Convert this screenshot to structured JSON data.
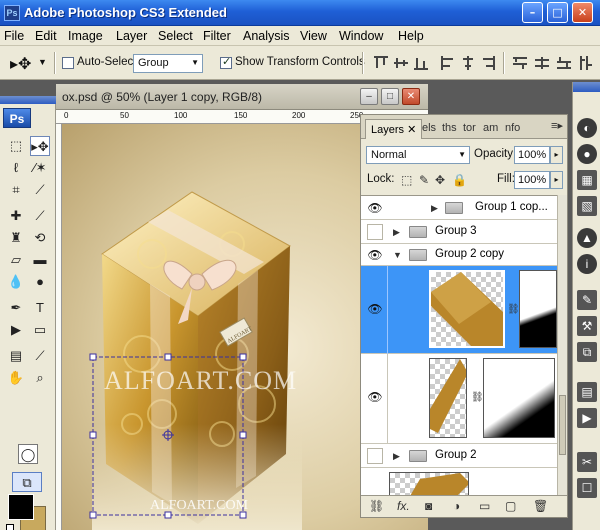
{
  "app": {
    "title": "Adobe Photoshop CS3 Extended",
    "logo_text": "Ps",
    "accent_color": "#1f5fd6"
  },
  "window_controls": {
    "minimize": "–",
    "maximize": "□",
    "close": "✕"
  },
  "menu": [
    "File",
    "Edit",
    "Image",
    "Layer",
    "Select",
    "Filter",
    "Analysis",
    "View",
    "Window",
    "Help"
  ],
  "options_bar": {
    "auto_select_label": "Auto-Select:",
    "auto_select_checked": false,
    "auto_select_value": "Group",
    "show_transform_label": "Show Transform Controls",
    "show_transform_checked": true
  },
  "document": {
    "title": "ox.psd @ 50% (Layer 1 copy, RGB/8)",
    "ruler_ticks": [
      "0",
      "50",
      "100",
      "150",
      "200",
      "250"
    ],
    "watermarks": [
      "ALFOART.COM",
      "ALFOART.COM"
    ],
    "tag_text": "ALFOART"
  },
  "layers_panel": {
    "tabs": [
      "Layers",
      "els",
      "ths",
      "tor",
      "am",
      "nfo"
    ],
    "blend_mode": "Normal",
    "opacity_label": "Opacity:",
    "opacity": "100%",
    "lock_label": "Lock:",
    "fill_label": "Fill:",
    "fill": "100%",
    "layers": [
      {
        "name": "Group 1 cop...",
        "visible": true
      },
      {
        "name": "Group 3",
        "visible": false
      },
      {
        "name": "Group 2 copy",
        "visible": true
      },
      {
        "name": "",
        "visible": true
      },
      {
        "name": "",
        "visible": true
      },
      {
        "name": "Group 2",
        "visible": false
      }
    ],
    "selection_color": "#3d95f7"
  },
  "toolbox": {
    "foreground": "#000000",
    "background": "#c8a95e"
  }
}
